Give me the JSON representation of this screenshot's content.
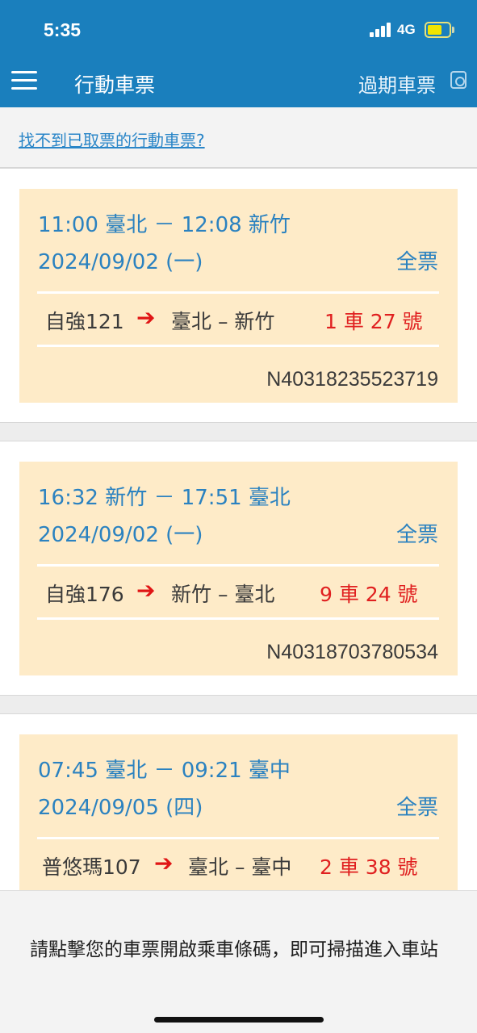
{
  "status": {
    "time": "5:35",
    "network": "4G"
  },
  "nav": {
    "title": "行動車票",
    "expired": "過期車票"
  },
  "help_link": "找不到已取票的行動車票?",
  "tickets": [
    {
      "route": "11:00 臺北 － 12:08 新竹",
      "date": "2024/09/02 (一)",
      "type": "全票",
      "train": "自強121",
      "stations": "臺北 – 新竹",
      "seat": "1 車 27 號",
      "ticket_no": "N40318235523719"
    },
    {
      "route": "16:32 新竹 － 17:51 臺北",
      "date": "2024/09/02 (一)",
      "type": "全票",
      "train": "自強176",
      "stations": "新竹 – 臺北",
      "seat": "9 車 24 號",
      "ticket_no": "N40318703780534"
    },
    {
      "route": "07:45 臺北 － 09:21 臺中",
      "date": "2024/09/05 (四)",
      "type": "全票",
      "train": "普悠瑪107",
      "stations": "臺北 – 臺中",
      "seat": "2 車 38 號"
    }
  ],
  "bottom_hint": "請點擊您的車票開啟乘車條碼，即可掃描進入車站",
  "icons": {
    "menu": "hamburger-icon",
    "expired": "camera-icon",
    "arrow": "arrow-right-icon",
    "signal": "signal-icon",
    "battery": "battery-charging-icon"
  },
  "colors": {
    "header": "#1a7fbd",
    "card": "#feebc8",
    "accent_blue": "#2b82c0",
    "seat_red": "#e02020"
  }
}
